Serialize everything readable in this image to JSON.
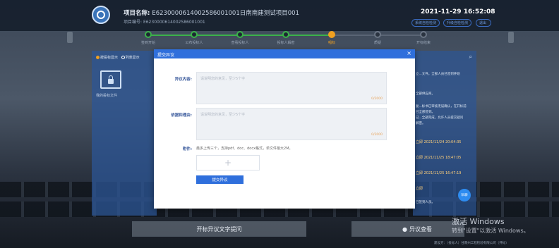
{
  "header": {
    "project_name_label": "项目名称:",
    "project_name_value": "E6230000614002586001001日南南建测试项目001",
    "project_no_label": "项目编号:",
    "project_no_value": "E6230000614002586001001",
    "datetime": "2021-11-29  16:52:08",
    "btn_1": "系统自检检测",
    "btn_2": "升级自检检测",
    "btn_3": "退出"
  },
  "steps": [
    {
      "label": "签到开始"
    },
    {
      "label": "公布投标人"
    },
    {
      "label": "查看投标人"
    },
    {
      "label": "投标人解密"
    },
    {
      "label": "唱标"
    },
    {
      "label": "质疑"
    },
    {
      "label": "开标结束"
    }
  ],
  "left_panel": {
    "radio_1": "按投标显示",
    "radio_2": "列表显示",
    "folder_label": "我的投标文件"
  },
  "right_panel": {
    "lines": [
      "立...文件。全部人员已签到开始",
      "全部供应商。",
      "复...标书已审核无误确认，在开标前",
      "已全部签到。",
      "已...全部完成，允许人员提交疑问",
      "解密。"
    ],
    "times": [
      "立即 2021/11/24 20:04:35",
      "立即 2021/11/25 18:47:05",
      "立即 2021/11/25 16:47:19",
      "立即"
    ],
    "chat_label": "私聊",
    "tail": "已签到人员。"
  },
  "modal": {
    "title": "提交异议",
    "close": "×",
    "objection_label": "异议内容:",
    "objection_placeholder": "请说明您的意见，至少5个字",
    "objection_count": "0/2000",
    "basis_label": "依据和理由:",
    "basis_placeholder": "请说明您的意见，至少5个字",
    "basis_count": "0/2000",
    "attach_label": "附件:",
    "attach_hint": "最多上传三个，支持pdf、doc、docx格式，单文件最大2M。",
    "upload_plus": "+",
    "submit": "提交异议"
  },
  "bottom": {
    "left_button": "开标异议文字提问",
    "right_button": "异议查看"
  },
  "watermark": {
    "line1": "激活 Windows",
    "line2": "转到\"设置\"以激活 Windows。"
  },
  "footer": "建设方：（投标人）甘南州工程检验有限公司（开标）"
}
